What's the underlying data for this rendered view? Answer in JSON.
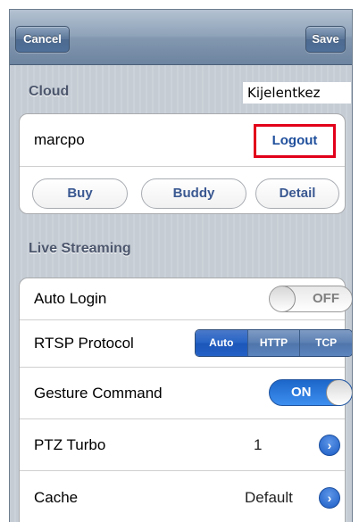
{
  "navbar": {
    "cancel_label": "Cancel",
    "save_label": "Save"
  },
  "cloud": {
    "header": "Cloud",
    "username": "marcpo",
    "logout_label": "Logout",
    "tooltip": "Kijelentkez",
    "buttons": {
      "buy": "Buy",
      "buddy": "Buddy",
      "detail": "Detail"
    }
  },
  "live_streaming": {
    "header": "Live Streaming",
    "auto_login": {
      "label": "Auto Login",
      "toggle": "OFF"
    },
    "rtsp_protocol": {
      "label": "RTSP Protocol",
      "options": [
        "Auto",
        "HTTP",
        "TCP"
      ],
      "selected": "Auto"
    },
    "gesture_command": {
      "label": "Gesture Command",
      "toggle": "ON"
    },
    "ptz_turbo": {
      "label": "PTZ Turbo",
      "value": "1"
    },
    "cache": {
      "label": "Cache",
      "value": "Default"
    }
  },
  "colors": {
    "accent_blue": "#2563c6",
    "highlight_red": "#e2001a",
    "section_text": "#4c566c"
  }
}
